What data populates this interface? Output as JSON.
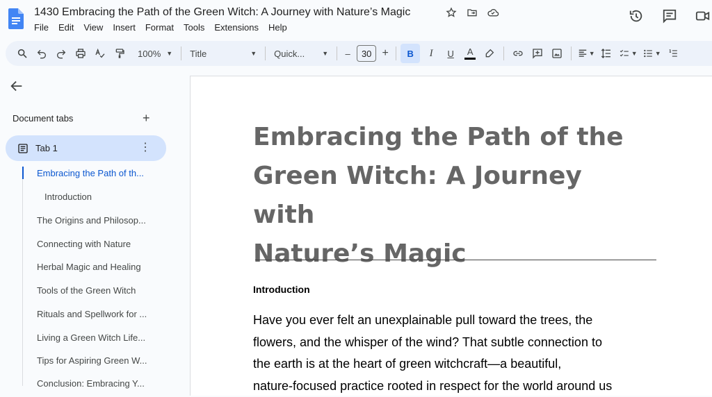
{
  "app": {
    "doc_title": "1430 Embracing the Path of the Green Witch: A Journey with Nature’s Magic",
    "menu": [
      "File",
      "Edit",
      "View",
      "Insert",
      "Format",
      "Tools",
      "Extensions",
      "Help"
    ],
    "icons": [
      "docs-logo-icon",
      "star-icon",
      "move-folder-icon",
      "cloud-status-icon",
      "history-icon",
      "comments-icon",
      "meet-icon"
    ]
  },
  "toolbar": {
    "zoom": "100%",
    "style": "Title",
    "font": "Quick...",
    "font_size": "30",
    "minus": "–",
    "plus": "+",
    "bold": "B",
    "italic": "I",
    "underline": "U",
    "text_color": "A"
  },
  "sidebar": {
    "tabs_label": "Document tabs",
    "add": "+",
    "tab1": "Tab 1",
    "outline": [
      "Embracing the Path of th...",
      "Introduction",
      "The Origins and Philosop...",
      "Connecting with Nature",
      "Herbal Magic and Healing",
      "Tools of the Green Witch",
      "Rituals and Spellwork for ...",
      "Living a Green Witch Life...",
      "Tips for Aspiring Green W...",
      "Conclusion: Embracing Y..."
    ]
  },
  "document": {
    "title_lines": [
      "Embracing the Path of the",
      "Green Witch: A Journey with",
      "Nature’s Magic"
    ],
    "heading": "Introduction",
    "paragraph_lines": [
      "Have you ever felt an unexplainable pull toward the trees, the",
      "flowers, and the whisper of the wind? That subtle connection to",
      "the earth is at the heart of green witchcraft—a beautiful,",
      "nature-focused practice rooted in respect for the world around us"
    ]
  },
  "colors": {
    "accent": "#0b57d0",
    "toolbar_bg": "#edf2fa",
    "tab_active_bg": "#d3e3fd",
    "title_gray": "#666666"
  }
}
